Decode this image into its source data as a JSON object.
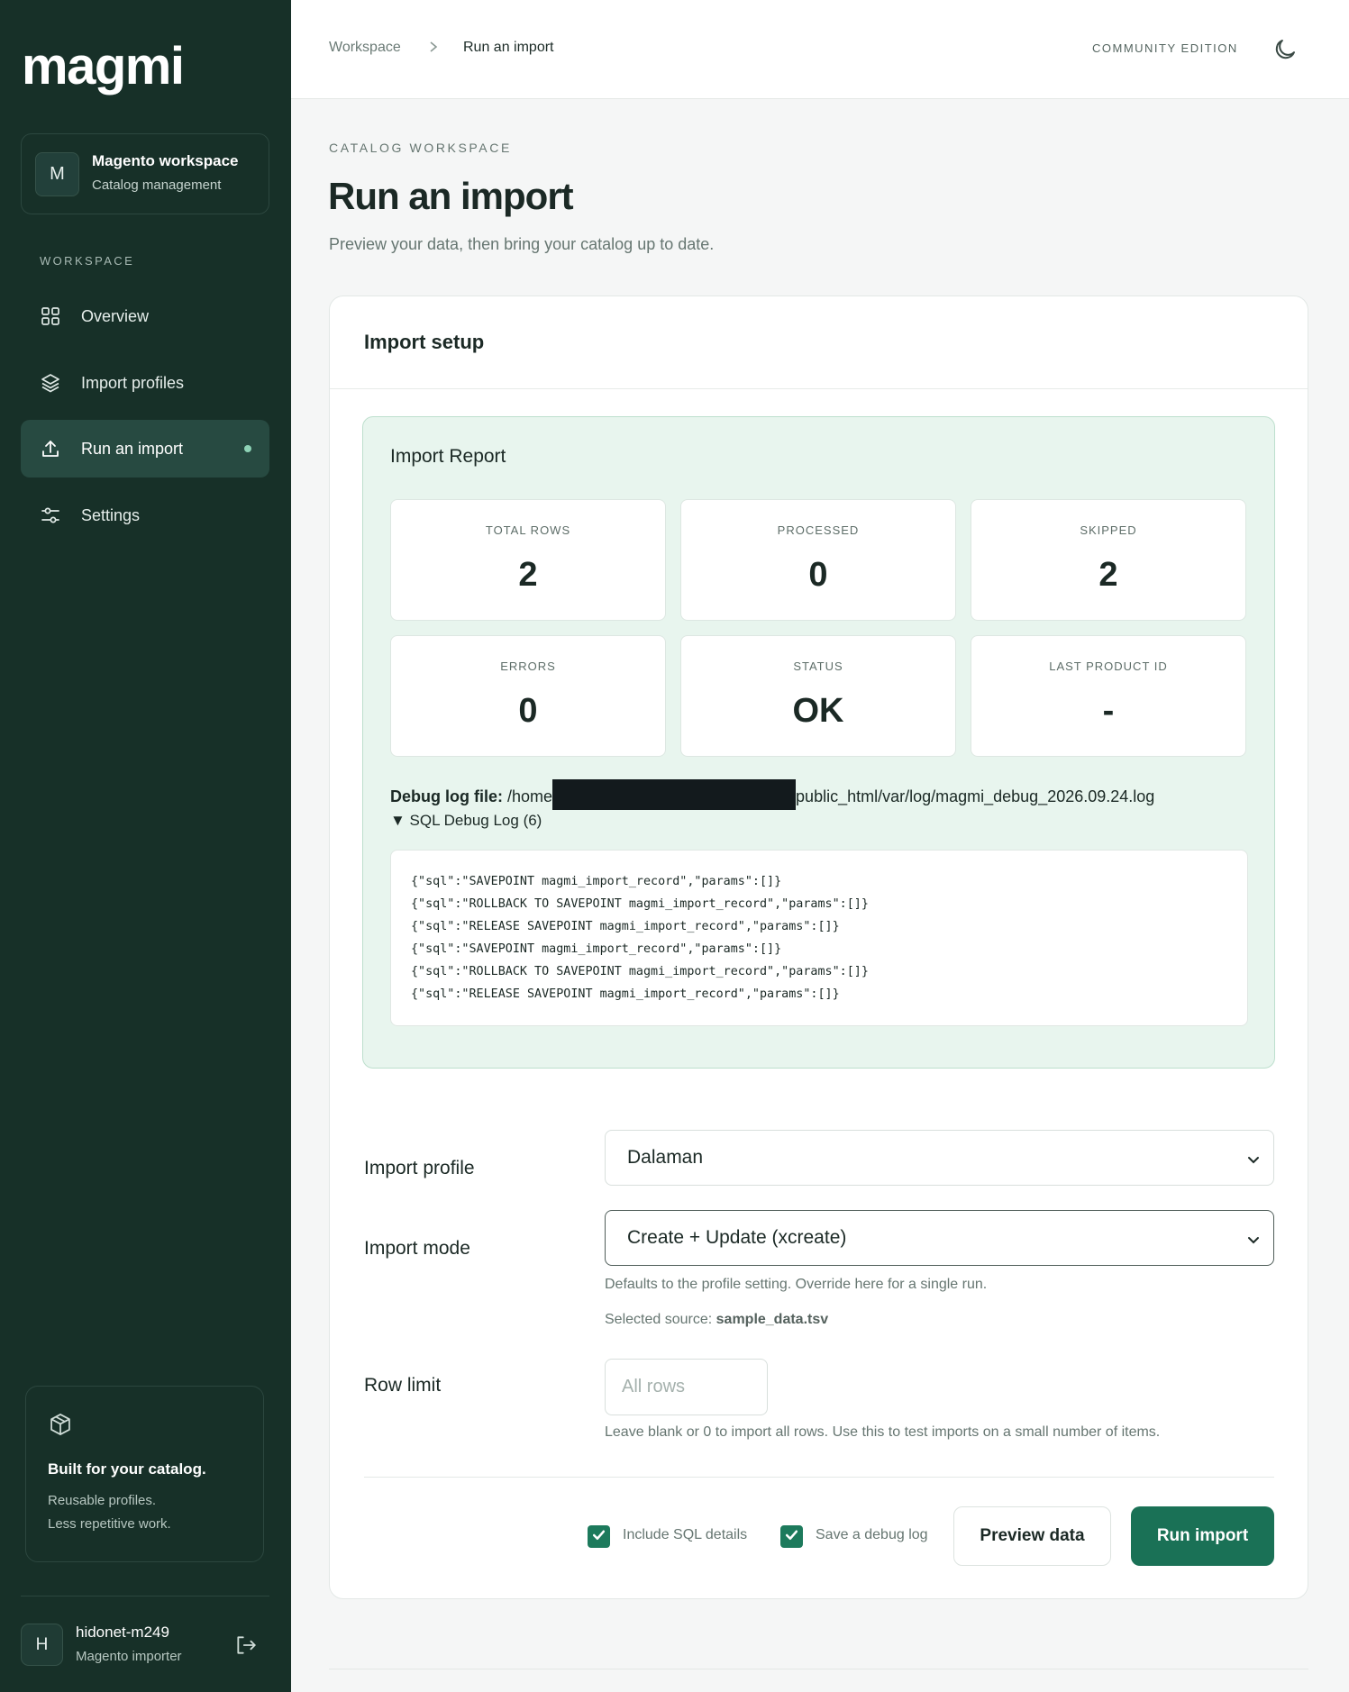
{
  "brand": {
    "logo": "magmi"
  },
  "workspace": {
    "avatar": "M",
    "name": "Magento workspace",
    "subtitle": "Catalog management"
  },
  "nav": {
    "heading": "WORKSPACE",
    "items": [
      {
        "label": "Overview",
        "icon": "grid-icon"
      },
      {
        "label": "Import profiles",
        "icon": "layers-icon"
      },
      {
        "label": "Run an import",
        "icon": "upload-icon",
        "active": true
      },
      {
        "label": "Settings",
        "icon": "sliders-icon"
      }
    ]
  },
  "promo": {
    "title": "Built for your catalog.",
    "line1": "Reusable profiles.",
    "line2": "Less repetitive work.",
    "icon": "box-icon"
  },
  "user": {
    "avatar": "H",
    "name": "hidonet-m249",
    "role": "Magento importer"
  },
  "topbar": {
    "breadcrumb": [
      "Workspace",
      "Run an import"
    ],
    "edition": "COMMUNITY EDITION",
    "theme_icon": "moon-icon"
  },
  "page": {
    "eyebrow": "CATALOG WORKSPACE",
    "title": "Run an import",
    "subtitle": "Preview your data, then bring your catalog up to date."
  },
  "setup": {
    "title": "Import setup"
  },
  "report": {
    "title": "Import Report",
    "stats": [
      {
        "label": "TOTAL ROWS",
        "value": "2"
      },
      {
        "label": "PROCESSED",
        "value": "0"
      },
      {
        "label": "SKIPPED",
        "value": "2"
      },
      {
        "label": "ERRORS",
        "value": "0"
      },
      {
        "label": "STATUS",
        "value": "OK"
      },
      {
        "label": "LAST PRODUCT ID",
        "value": "-"
      }
    ],
    "debug_label": "Debug log file:",
    "debug_path_start": "/home",
    "debug_path_end": "public_html/var/log/magmi_debug_2026.09.24.log",
    "sql_summary": "▼ SQL Debug Log (6)",
    "sql_lines": [
      "{\"sql\":\"SAVEPOINT magmi_import_record\",\"params\":[]}",
      "{\"sql\":\"ROLLBACK TO SAVEPOINT magmi_import_record\",\"params\":[]}",
      "{\"sql\":\"RELEASE SAVEPOINT magmi_import_record\",\"params\":[]}",
      "{\"sql\":\"SAVEPOINT magmi_import_record\",\"params\":[]}",
      "{\"sql\":\"ROLLBACK TO SAVEPOINT magmi_import_record\",\"params\":[]}",
      "{\"sql\":\"RELEASE SAVEPOINT magmi_import_record\",\"params\":[]}"
    ]
  },
  "form": {
    "profile_label": "Import profile",
    "profile_value": "Dalaman",
    "mode_label": "Import mode",
    "mode_value": "Create + Update (xcreate)",
    "mode_hint": "Defaults to the profile setting. Override here for a single run.",
    "source_label": "Selected source:",
    "source_file": "sample_data.tsv",
    "rowlimit_label": "Row limit",
    "rowlimit_placeholder": "All rows",
    "rowlimit_hint": "Leave blank or 0 to import all rows. Use this to test imports on a small number of items."
  },
  "actions": {
    "sql_details_label": "Include SQL details",
    "sql_details_checked": true,
    "debug_log_label": "Save a debug log",
    "debug_log_checked": true,
    "preview_label": "Preview data",
    "run_label": "Run import"
  },
  "colors": {
    "sidebar": "#173028",
    "accent": "#1a7156",
    "report_bg": "#e8f5ee"
  }
}
